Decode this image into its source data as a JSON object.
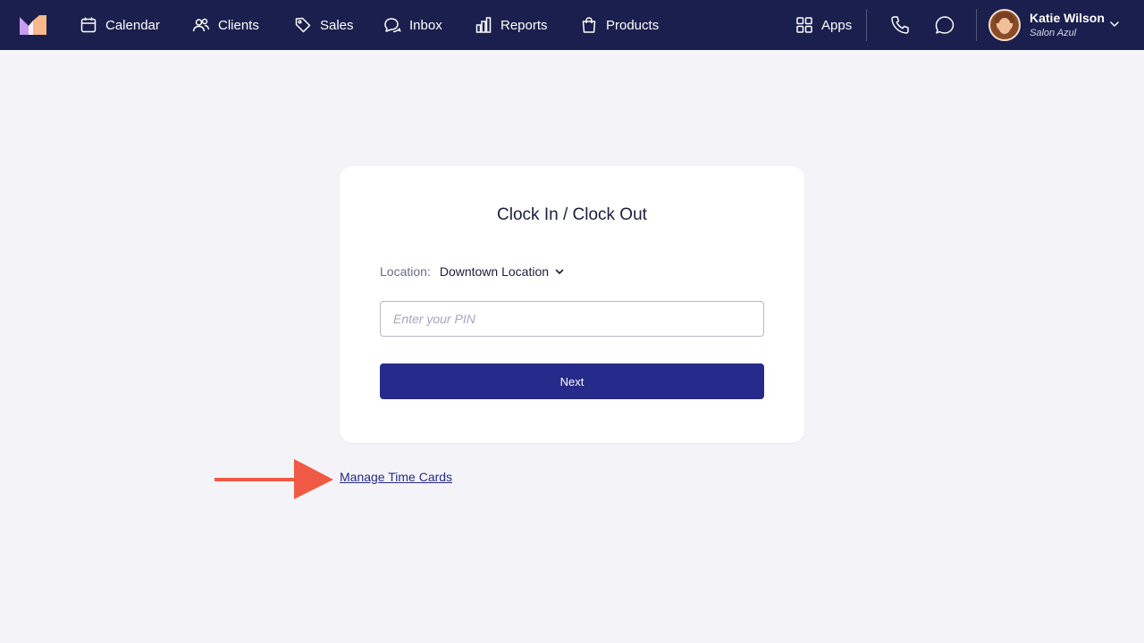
{
  "nav": {
    "items": [
      {
        "label": "Calendar",
        "icon": "calendar-icon"
      },
      {
        "label": "Clients",
        "icon": "clients-icon"
      },
      {
        "label": "Sales",
        "icon": "tag-icon"
      },
      {
        "label": "Inbox",
        "icon": "chat-bubbles-icon"
      },
      {
        "label": "Reports",
        "icon": "bar-chart-icon"
      },
      {
        "label": "Products",
        "icon": "shopping-bag-icon"
      }
    ],
    "apps_label": "Apps"
  },
  "profile": {
    "name": "Katie Wilson",
    "salon": "Salon Azul"
  },
  "card": {
    "title": "Clock In / Clock Out",
    "location_label": "Location:",
    "location_value": "Downtown Location",
    "pin_placeholder": "Enter your PIN",
    "pin_value": "",
    "next_label": "Next"
  },
  "manage_link": "Manage Time Cards",
  "colors": {
    "topbar": "#1b1f4d",
    "accent": "#262a8a",
    "background": "#f4f4f8",
    "annotation_arrow": "#f05a45"
  }
}
